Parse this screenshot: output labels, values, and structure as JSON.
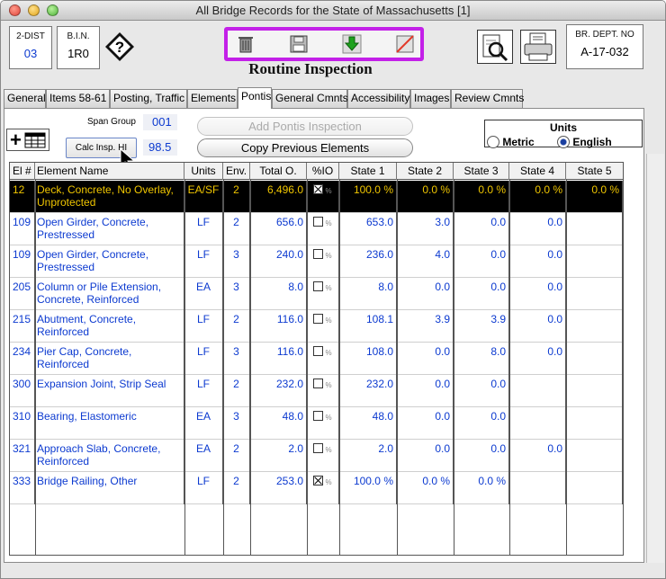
{
  "window": {
    "title": "All Bridge Records for the State of Massachusetts [1]"
  },
  "header": {
    "dist": {
      "label": "2-DIST",
      "value": "03"
    },
    "bin": {
      "label": "B.I.N.",
      "value": "1R0"
    },
    "br_dept": {
      "label": "BR. DEPT. NO",
      "value": "A-17-032"
    },
    "page_title": "Routine Inspection"
  },
  "icons": {
    "help": "help-question-icon",
    "trash": "trash-icon",
    "save": "save-disk-icon",
    "download": "green-down-arrow-icon",
    "delete": "strike-delete-icon",
    "magnify": "magnifier-document-icon",
    "printer": "printer-icon",
    "add": "add-table-icon"
  },
  "tabs": [
    {
      "label": "General"
    },
    {
      "label": "Items 58-61"
    },
    {
      "label": "Posting, Traffic"
    },
    {
      "label": "Elements"
    },
    {
      "label": "Pontis"
    },
    {
      "label": "General Cmnts"
    },
    {
      "label": "Accessibility"
    },
    {
      "label": "Images"
    },
    {
      "label": "Review Cmnts"
    }
  ],
  "pontis": {
    "span_group_label": "Span Group",
    "span_group_value": "001",
    "calc_label": "Calc Insp. HI",
    "calc_value": "98.5",
    "add_button": "Add Pontis Inspection",
    "copy_button": "Copy Previous Elements",
    "units": {
      "title": "Units",
      "metric": "Metric",
      "english": "English",
      "selected": "English"
    }
  },
  "table": {
    "headers": [
      "El #",
      "Element Name",
      "Units",
      "Env.",
      "Total O.",
      "%IO",
      "State 1",
      "State 2",
      "State 3",
      "State 4",
      "State 5"
    ],
    "rows": [
      {
        "el": "12",
        "name": "Deck, Concrete, No Overlay, Unprotected",
        "units": "EA/SF",
        "env": "2",
        "total": "6,496.0",
        "pio": true,
        "s1": "100.0 %",
        "s2": "0.0 %",
        "s3": "0.0 %",
        "s4": "0.0 %",
        "s5": "0.0 %",
        "selected": true
      },
      {
        "el": "109",
        "name": "Open Girder, Concrete, Prestressed",
        "units": "LF",
        "env": "2",
        "total": "656.0",
        "pio": false,
        "s1": "653.0",
        "s2": "3.0",
        "s3": "0.0",
        "s4": "0.0",
        "s5": ""
      },
      {
        "el": "109",
        "name": "Open Girder, Concrete, Prestressed",
        "units": "LF",
        "env": "3",
        "total": "240.0",
        "pio": false,
        "s1": "236.0",
        "s2": "4.0",
        "s3": "0.0",
        "s4": "0.0",
        "s5": ""
      },
      {
        "el": "205",
        "name": "Column or Pile Extension, Concrete, Reinforced",
        "units": "EA",
        "env": "3",
        "total": "8.0",
        "pio": false,
        "s1": "8.0",
        "s2": "0.0",
        "s3": "0.0",
        "s4": "0.0",
        "s5": ""
      },
      {
        "el": "215",
        "name": "Abutment, Concrete, Reinforced",
        "units": "LF",
        "env": "2",
        "total": "116.0",
        "pio": false,
        "s1": "108.1",
        "s2": "3.9",
        "s3": "3.9",
        "s4": "0.0",
        "s5": ""
      },
      {
        "el": "234",
        "name": "Pier Cap, Concrete, Reinforced",
        "units": "LF",
        "env": "3",
        "total": "116.0",
        "pio": false,
        "s1": "108.0",
        "s2": "0.0",
        "s3": "8.0",
        "s4": "0.0",
        "s5": ""
      },
      {
        "el": "300",
        "name": "Expansion Joint, Strip Seal",
        "units": "LF",
        "env": "2",
        "total": "232.0",
        "pio": false,
        "s1": "232.0",
        "s2": "0.0",
        "s3": "0.0",
        "s4": "",
        "s5": ""
      },
      {
        "el": "310",
        "name": "Bearing, Elastomeric",
        "units": "EA",
        "env": "3",
        "total": "48.0",
        "pio": false,
        "s1": "48.0",
        "s2": "0.0",
        "s3": "0.0",
        "s4": "",
        "s5": ""
      },
      {
        "el": "321",
        "name": "Approach Slab, Concrete, Reinforced",
        "units": "EA",
        "env": "2",
        "total": "2.0",
        "pio": false,
        "s1": "2.0",
        "s2": "0.0",
        "s3": "0.0",
        "s4": "0.0",
        "s5": ""
      },
      {
        "el": "333",
        "name": "Bridge Railing, Other",
        "units": "LF",
        "env": "2",
        "total": "253.0",
        "pio": true,
        "s1": "100.0 %",
        "s2": "0.0 %",
        "s3": "0.0 %",
        "s4": "",
        "s5": ""
      }
    ]
  }
}
